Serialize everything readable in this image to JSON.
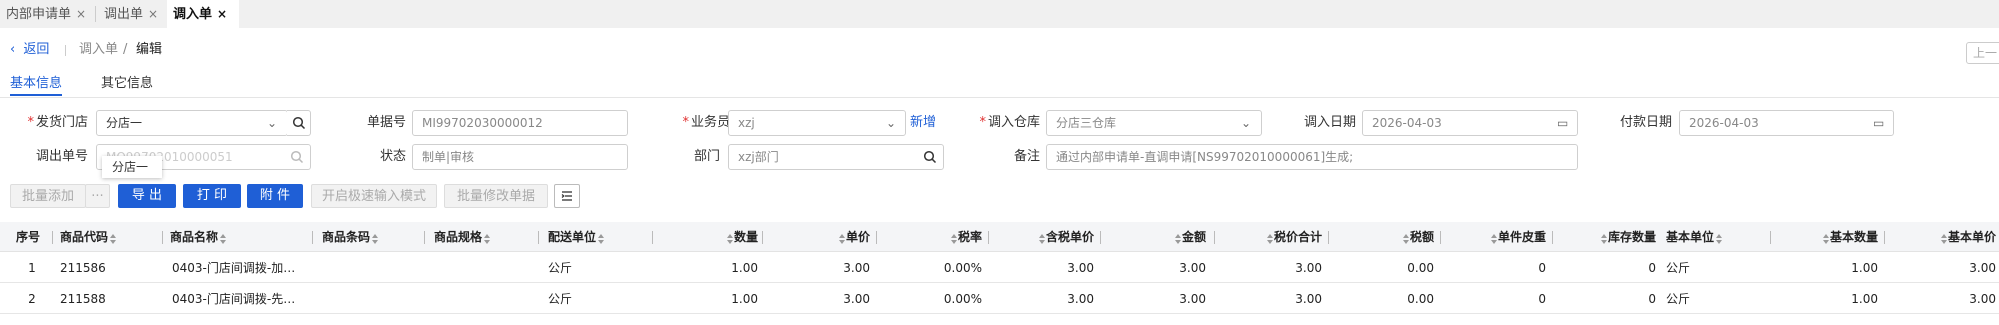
{
  "tabs": [
    {
      "label": "内部申请单",
      "close": "×"
    },
    {
      "label": "调出单",
      "close": "×"
    },
    {
      "label": "调入单",
      "close": "×"
    }
  ],
  "breadcrumb": {
    "back": "返回",
    "section": "调入单",
    "sep": "/",
    "current": "编辑"
  },
  "top_right_button": "上一",
  "subtabs": [
    "基本信息",
    "其它信息"
  ],
  "form": {
    "ship_store": {
      "label": "发货门店",
      "value": "分店一"
    },
    "doc_no": {
      "label": "单据号",
      "value": "MI99702030000012"
    },
    "salesperson": {
      "label": "业务员",
      "value": "xzj",
      "link": "新增"
    },
    "in_warehouse": {
      "label": "调入仓库",
      "value": "分店三仓库"
    },
    "in_date": {
      "label": "调入日期",
      "value": "2026-04-03"
    },
    "pay_date": {
      "label": "付款日期",
      "value": "2026-04-03"
    },
    "out_doc_no": {
      "label": "调出单号",
      "value": "MO99702010000051"
    },
    "status": {
      "label": "状态",
      "value": "制单|审核"
    },
    "department": {
      "label": "部门",
      "value": "xzj部门"
    },
    "remark": {
      "label": "备注",
      "value": "通过内部申请单-直调申请[NS99702010000061]生成;"
    },
    "popup_option": "分店一"
  },
  "toolbar": {
    "batch_add": "批量添加",
    "more": "···",
    "export": "导 出",
    "print": "打 印",
    "attach": "附 件",
    "quick_mode": "开启极速输入模式",
    "batch_edit": "批量修改单据"
  },
  "colors": {
    "accent": "#1f5fd6",
    "required": "#e03030"
  },
  "table": {
    "headers": {
      "seq": "序号",
      "code": "商品代码",
      "name": "商品名称",
      "barcode": "商品条码",
      "spec": "商品规格",
      "unit": "配送单位",
      "qty": "数量",
      "price": "单价",
      "tax_rate": "税率",
      "tax_price": "含税单价",
      "amount": "金额",
      "tax_total": "税价合计",
      "tax": "税额",
      "tare": "单件皮重",
      "stock": "库存数量",
      "base_unit": "基本单位",
      "base_qty": "基本数量",
      "base_price": "基本单价"
    },
    "rows": [
      {
        "seq": "1",
        "code": "211586",
        "name": "0403-门店间调拨-加…",
        "barcode": "",
        "spec": "",
        "unit": "公斤",
        "qty": "1.00",
        "price": "3.00",
        "tax_rate": "0.00%",
        "tax_price": "3.00",
        "amount": "3.00",
        "tax_total": "3.00",
        "tax": "0.00",
        "tare": "0",
        "stock": "0",
        "base_unit": "公斤",
        "base_qty": "1.00",
        "base_price": "3.00"
      },
      {
        "seq": "2",
        "code": "211588",
        "name": "0403-门店间调拨-先…",
        "barcode": "",
        "spec": "",
        "unit": "公斤",
        "qty": "1.00",
        "price": "3.00",
        "tax_rate": "0.00%",
        "tax_price": "3.00",
        "amount": "3.00",
        "tax_total": "3.00",
        "tax": "0.00",
        "tare": "0",
        "stock": "0",
        "base_unit": "公斤",
        "base_qty": "1.00",
        "base_price": "3.00"
      }
    ]
  }
}
